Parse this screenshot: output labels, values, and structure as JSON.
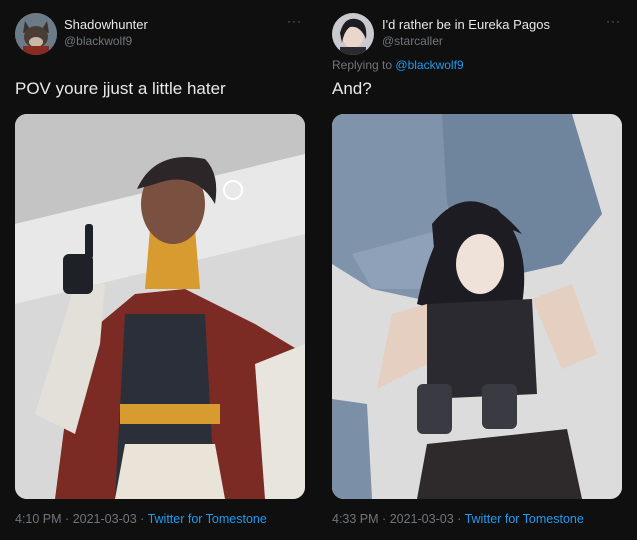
{
  "tweets": [
    {
      "display_name": "Shadowhunter",
      "handle": "@blackwolf9",
      "more": "···",
      "text": "POV youre jjust a little hater",
      "time": "4:10 PM",
      "date": "2021-03-03",
      "source": "Twitter for Tomestone",
      "separator": "·"
    },
    {
      "display_name": "I'd rather be in Eureka Pagos",
      "handle": "@starcaller",
      "more": "···",
      "replying_prefix": "Replying to",
      "replying_to": "@blackwolf9",
      "text": "And?",
      "time": "4:33 PM",
      "date": "2021-03-03",
      "source": "Twitter for Tomestone",
      "separator": "·"
    }
  ],
  "colors": {
    "background": "#0f0f10",
    "text_primary": "#e7e9ea",
    "text_secondary": "#71767b",
    "link": "#1d9bf0"
  }
}
